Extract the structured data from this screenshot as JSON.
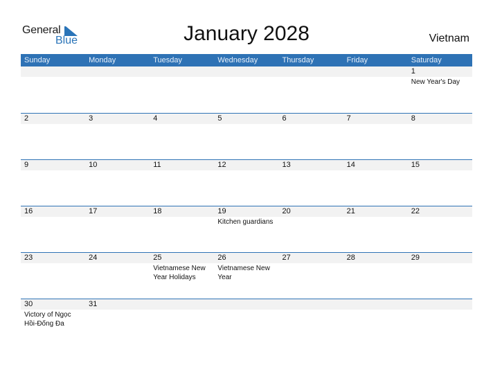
{
  "logo": {
    "line1": "General",
    "line2": "Blue"
  },
  "title": "January 2028",
  "country": "Vietnam",
  "colors": {
    "accent": "#2e72b5",
    "date_strip": "#f2f2f2"
  },
  "weekdays": [
    "Sunday",
    "Monday",
    "Tuesday",
    "Wednesday",
    "Thursday",
    "Friday",
    "Saturday"
  ],
  "weeks": [
    [
      {
        "day": "",
        "event": ""
      },
      {
        "day": "",
        "event": ""
      },
      {
        "day": "",
        "event": ""
      },
      {
        "day": "",
        "event": ""
      },
      {
        "day": "",
        "event": ""
      },
      {
        "day": "",
        "event": ""
      },
      {
        "day": "1",
        "event": "New Year's Day"
      }
    ],
    [
      {
        "day": "2",
        "event": ""
      },
      {
        "day": "3",
        "event": ""
      },
      {
        "day": "4",
        "event": ""
      },
      {
        "day": "5",
        "event": ""
      },
      {
        "day": "6",
        "event": ""
      },
      {
        "day": "7",
        "event": ""
      },
      {
        "day": "8",
        "event": ""
      }
    ],
    [
      {
        "day": "9",
        "event": ""
      },
      {
        "day": "10",
        "event": ""
      },
      {
        "day": "11",
        "event": ""
      },
      {
        "day": "12",
        "event": ""
      },
      {
        "day": "13",
        "event": ""
      },
      {
        "day": "14",
        "event": ""
      },
      {
        "day": "15",
        "event": ""
      }
    ],
    [
      {
        "day": "16",
        "event": ""
      },
      {
        "day": "17",
        "event": ""
      },
      {
        "day": "18",
        "event": ""
      },
      {
        "day": "19",
        "event": "Kitchen guardians"
      },
      {
        "day": "20",
        "event": ""
      },
      {
        "day": "21",
        "event": ""
      },
      {
        "day": "22",
        "event": ""
      }
    ],
    [
      {
        "day": "23",
        "event": ""
      },
      {
        "day": "24",
        "event": ""
      },
      {
        "day": "25",
        "event": "Vietnamese New Year Holidays"
      },
      {
        "day": "26",
        "event": "Vietnamese New Year"
      },
      {
        "day": "27",
        "event": ""
      },
      {
        "day": "28",
        "event": ""
      },
      {
        "day": "29",
        "event": ""
      }
    ],
    [
      {
        "day": "30",
        "event": "Victory of Ngọc Hồi-Đống Đa"
      },
      {
        "day": "31",
        "event": ""
      },
      {
        "day": "",
        "event": ""
      },
      {
        "day": "",
        "event": ""
      },
      {
        "day": "",
        "event": ""
      },
      {
        "day": "",
        "event": ""
      },
      {
        "day": "",
        "event": ""
      }
    ]
  ]
}
